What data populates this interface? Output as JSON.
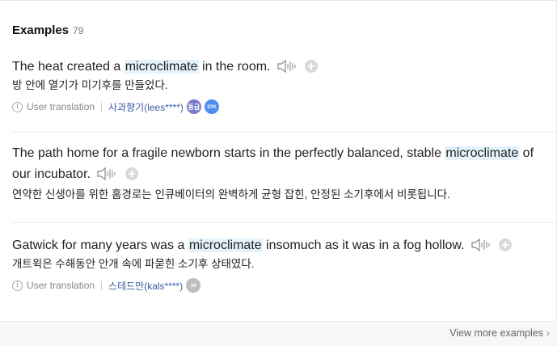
{
  "header": {
    "title": "Examples",
    "count": "79"
  },
  "examples": [
    {
      "pre": "The heat created a ",
      "keyword": "microclimate",
      "post": " in the room.",
      "translation": "방 안에 열기가 미기후를 만들었다.",
      "source_label": "User translation",
      "user": "사과향기(lees****)",
      "badges": [
        "등급",
        "37K"
      ]
    },
    {
      "pre": "The path home for a fragile newborn starts in the perfectly balanced, stable ",
      "keyword": "microclimate",
      "post": " of our incubator.",
      "translation": "연약한 신생아를 위한 홈경로는 인큐베이터의 완벽하게 균형 잡힌, 안정된 소기후에서 비롯됩니다."
    },
    {
      "pre": "Gatwick for many years was a ",
      "keyword": "microclimate",
      "post": " insomuch as it was in a fog hollow.",
      "translation": "개트윅은 수해동안 안개 속에 파묻힌 소기후 상태였다.",
      "source_label": "User translation",
      "user": "스테드만(kals****)",
      "badges": [
        "30"
      ]
    }
  ],
  "footer": {
    "more_label": "View more examples"
  },
  "icons": {
    "speaker": "speaker-icon",
    "add": "add-icon",
    "info": "info-icon",
    "chevron": "chevron-right-icon"
  },
  "colors": {
    "highlight": "#e4f3fb",
    "user_link": "#3a5ca8",
    "badge_blue": "#4f8ef0"
  }
}
